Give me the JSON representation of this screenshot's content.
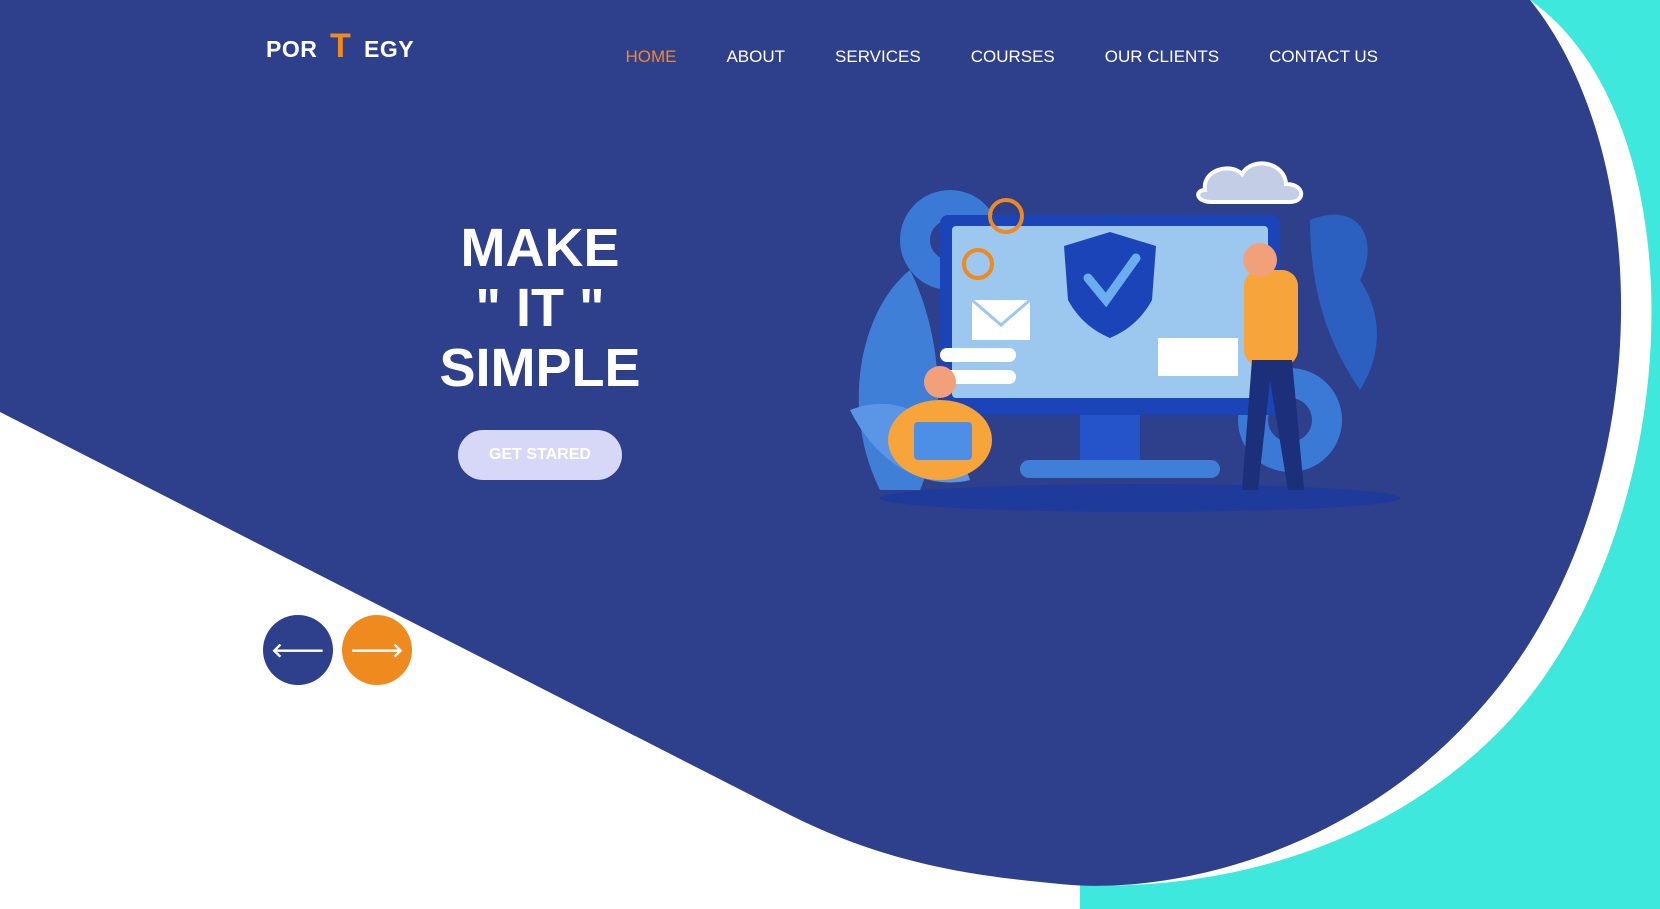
{
  "brand": {
    "name_left": "POR",
    "name_mid": "T",
    "name_right": "EGY"
  },
  "colors": {
    "primary": "#2e3f8b",
    "accent": "#ee8a1e",
    "teal": "#3ee8dc",
    "button_bg": "#d7d8f8"
  },
  "nav": {
    "items": [
      {
        "label": "HOME",
        "active": true
      },
      {
        "label": "ABOUT",
        "active": false
      },
      {
        "label": "SERVICES",
        "active": false
      },
      {
        "label": "COURSES",
        "active": false
      },
      {
        "label": "OUR CLIENTS",
        "active": false
      },
      {
        "label": "CONTACT US",
        "active": false
      }
    ]
  },
  "hero": {
    "line1": "MAKE",
    "line2": "\" IT \"",
    "line3": "SIMPLE",
    "cta_label": "GET STARED"
  },
  "slider": {
    "prev_icon": "arrow-left-icon",
    "next_icon": "arrow-right-icon",
    "prev_glyph": "🡐",
    "next_glyph": "🡒"
  }
}
